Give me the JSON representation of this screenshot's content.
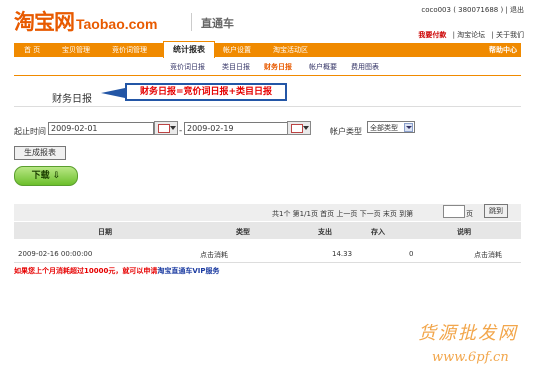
{
  "header": {
    "logo_cn": "淘宝网",
    "logo_en": "Taobao.com",
    "sub_brand": "直通车",
    "user_line": "coco003 ( 380071688 ) | 退出",
    "links": [
      "我要付款",
      "| 淘宝论坛",
      "| 关于我们"
    ]
  },
  "nav": {
    "items": [
      "首 页",
      "宝贝管理",
      "竞价词管理",
      "统计报表",
      "帐户设置",
      "淘宝活动区"
    ],
    "active_index": 3,
    "help": "帮助中心"
  },
  "subnav": {
    "items": [
      "竞价词日报",
      "类目日报",
      "财务日报",
      "帐户概要",
      "费用图表"
    ],
    "active_index": 2
  },
  "page_title": "财务日报",
  "callout": "财务日报=竞价词日报+类目日报",
  "form": {
    "start_label": "起止时间",
    "start_date": "2009-02-01",
    "dash": "-",
    "end_date": "2009-02-19",
    "account_label": "帐户类型",
    "account_value": "全部类型",
    "generate_button": "生成报表",
    "download_button": "下载 ⇩"
  },
  "pager": {
    "summary": "共1个 第1/1页  首页  上一页  下一页  末页  到第",
    "unit": "页",
    "jump_button": "跳到"
  },
  "table": {
    "headers": [
      "日期",
      "类型",
      "支出",
      "存入",
      "说明"
    ],
    "rows": [
      [
        "2009-02-16 00:00:00",
        "点击消耗",
        "14.33",
        "0",
        "点击消耗"
      ]
    ]
  },
  "note": {
    "red_part": "如果您上个月消耗超过10000元，就可以申请",
    "blue_part": "淘宝直通车VIP服务"
  },
  "watermark": {
    "line1": "货源批发网",
    "line2": "www.6pf.cn"
  }
}
